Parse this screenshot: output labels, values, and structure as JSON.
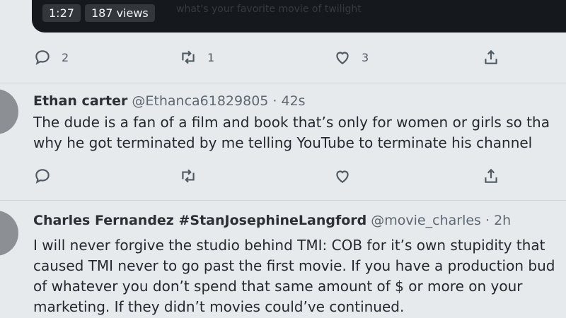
{
  "video": {
    "duration": "1:27",
    "views": "187 views",
    "caption": "what's your favorite movie of twilight"
  },
  "first_tweet_actions": {
    "reply_count": "2",
    "retweet_count": "1",
    "like_count": "3"
  },
  "tweets": [
    {
      "name": "Ethan carter",
      "handle": "@Ethanca61829805",
      "time": "· 42s",
      "lines": [
        "The dude is a fan of a film and book that’s only for women or girls so tha",
        "why he got terminated by me telling YouTube to terminate his channel"
      ]
    },
    {
      "name": "Charles Fernandez #StanJosephineLangford",
      "handle": "@movie_charles",
      "time": "· 2h",
      "lines": [
        "I will never forgive the studio behind TMI: COB for it’s own stupidity that",
        "caused TMI never to go past the first movie. If you have a production bud",
        "of whatever you don’t spend that same amount of $ or more on your",
        "marketing. If they didn’t movies could’ve continued."
      ]
    }
  ],
  "icons": {
    "reply": "reply-icon",
    "retweet": "retweet-icon",
    "like": "heart-icon",
    "share": "share-icon"
  }
}
